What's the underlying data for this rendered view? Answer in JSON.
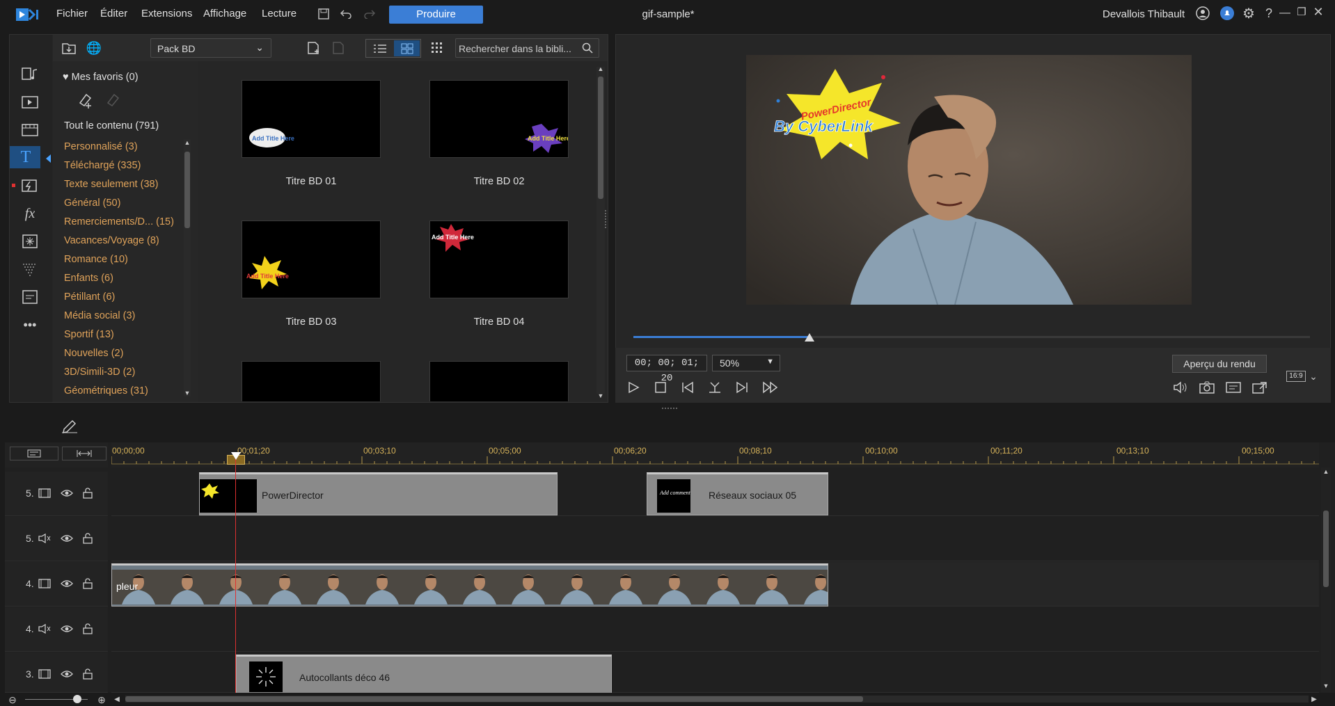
{
  "menubar": {
    "items": [
      "Fichier",
      "Éditer",
      "Extensions",
      "Affichage",
      "Lecture"
    ],
    "produce": "Produire",
    "title": "gif-sample*",
    "user": "Devallois Thibault"
  },
  "library": {
    "pack": "Pack BD",
    "search_placeholder": "Rechercher dans la bibli...",
    "favorites": "Mes favoris (0)",
    "all_content": "Tout le contenu (791)",
    "categories": [
      "Personnalisé  (3)",
      "Téléchargé  (335)",
      "Texte seulement  (38)",
      "Général  (50)",
      "Remerciements/D...  (15)",
      "Vacances/Voyage  (8)",
      "Romance  (10)",
      "Enfants  (6)",
      "Pétillant  (6)",
      "Média social  (3)",
      "Sportif  (13)",
      "Nouvelles  (2)",
      "3D/Simili-3D  (2)",
      "Géométriques  (31)"
    ],
    "titles": [
      "Titre BD 01",
      "Titre BD 02",
      "Titre BD 03",
      "Titre BD 04"
    ],
    "thumb_text": "Add Title Here"
  },
  "preview": {
    "overlay_line1": "PowerDirector",
    "overlay_line2": "By CyberLink",
    "timecode": "00; 00; 01; 20",
    "zoom": "50%",
    "render": "Aperçu du rendu",
    "aspect": "16:9",
    "progress": 0.26
  },
  "timeline": {
    "ruler": [
      "00;00;00",
      "00;01;20",
      "00;03;10",
      "00;05;00",
      "00;06;20",
      "00;08;10",
      "00;10;00",
      "00;11;20",
      "00;13;10",
      "00;15;00"
    ],
    "tracks": [
      {
        "num": "5."
      },
      {
        "num": "5."
      },
      {
        "num": "4."
      },
      {
        "num": "4."
      },
      {
        "num": "3."
      }
    ],
    "clips": {
      "c1": "PowerDirector",
      "c2": "Réseaux sociaux 05",
      "c3": "pleur",
      "c4": "Autocollants déco 46",
      "c2_thumb_text": "Add comment share"
    }
  },
  "colors": {
    "accent": "#3b7ed6",
    "category": "#e0a35a",
    "playhead": "#e03030",
    "ruler_text": "#d8b45a"
  }
}
